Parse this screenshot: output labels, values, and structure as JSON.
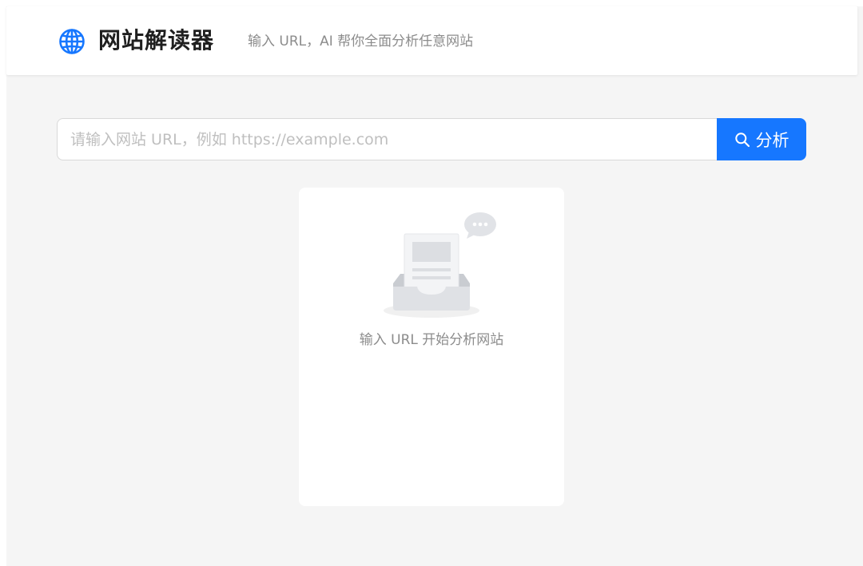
{
  "header": {
    "logo_icon": "globe-icon",
    "title": "网站解读器",
    "subtitle": "输入 URL，AI 帮你全面分析任意网站"
  },
  "search": {
    "value": "",
    "placeholder": "请输入网站 URL，例如 https://example.com",
    "button_icon": "search-icon",
    "button_label": "分析"
  },
  "empty_state": {
    "illustration": "empty-inbox-illustration",
    "message": "输入 URL 开始分析网站"
  },
  "colors": {
    "primary": "#1677ff",
    "page_background": "#f5f5f5",
    "card_background": "#ffffff",
    "muted_text": "#8c8c8c",
    "placeholder_text": "#bfbfbf"
  }
}
